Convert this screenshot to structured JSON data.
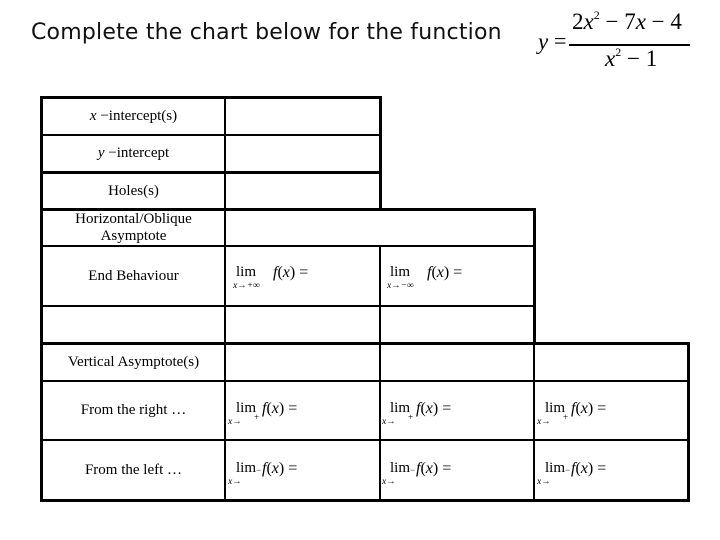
{
  "header": {
    "title": "Complete the chart below for the function",
    "formula": {
      "lhs": "y",
      "equals": "=",
      "numerator": "2x² − 7x − 4",
      "denominator": "x² − 1",
      "numerator_parts": [
        "2",
        "x",
        "2",
        " − 7",
        "x",
        " − 4"
      ],
      "denominator_parts": [
        "x",
        "2",
        " − 1"
      ]
    }
  },
  "table": {
    "rows": {
      "x_intercepts": {
        "var": "x",
        "label": " −intercept(s)"
      },
      "y_intercept": {
        "var": "y",
        "label": " −intercept"
      },
      "holes": {
        "label": "Holes(s)"
      },
      "asymptote": {
        "line1": "Horizontal/Oblique",
        "line2": "Asymptote"
      },
      "end_behaviour": {
        "label": "End Behaviour"
      },
      "vertical": {
        "label": "Vertical Asymptote(s)"
      },
      "from_right": {
        "label": "From the right …"
      },
      "from_left": {
        "label": "From the left …"
      }
    },
    "limits": {
      "word": "lim",
      "fx": "f(x) =",
      "end_pos_sub": "x→+∞",
      "end_neg_sub": "x→−∞",
      "arrow_sub": "x→",
      "plus": "+",
      "minus": "−"
    }
  }
}
